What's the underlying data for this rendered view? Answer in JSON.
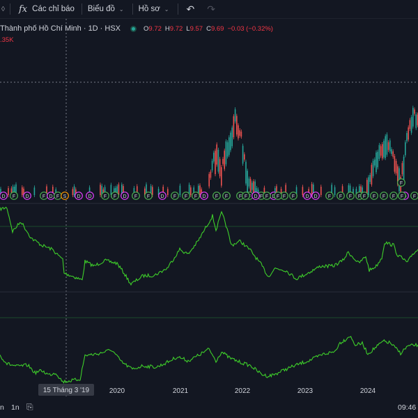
{
  "toolbar": {
    "fx_icon": "fx-icon",
    "indicators_label": "Các chỉ báo",
    "chart_type_label": "Biểu đồ",
    "profile_label": "Hồ sơ"
  },
  "legend": {
    "title": "Thành phố Hồ Chí Minh · 1D · HSX",
    "open_key": "O",
    "open": "9.72",
    "high_key": "H",
    "high": "9.72",
    "low_key": "L",
    "low": "9.57",
    "close_key": "C",
    "close": "9.69",
    "change": "−0.03 (−0.32%)",
    "volume": ".35K"
  },
  "axis": {
    "years": [
      "2020",
      "2021",
      "2022",
      "2023",
      "2024"
    ],
    "crosshair_label": "15 Tháng 3 '19",
    "time": "09:46"
  },
  "ranges": [
    "n",
    "1n"
  ],
  "colors": {
    "up": "#26a69a",
    "down": "#ef5350",
    "line": "#3ecf2a",
    "background": "#131722",
    "dividend": "#e040fb",
    "financial": "#4caf50"
  },
  "events": {
    "marks": [
      "D",
      "F",
      "D",
      "F",
      "D",
      "F",
      "S",
      "D",
      "D",
      "F",
      "F",
      "D",
      "F",
      "F",
      "D",
      "F",
      "F",
      "F",
      "D",
      "F",
      "F",
      "F",
      "F",
      "F",
      "D",
      "F",
      "F",
      "D",
      "D",
      "F",
      "F",
      "F",
      "F",
      "F",
      "F",
      "F",
      "F",
      "D",
      "F",
      "F",
      "D",
      "F",
      "F",
      "F"
    ],
    "standalone": "F"
  }
}
